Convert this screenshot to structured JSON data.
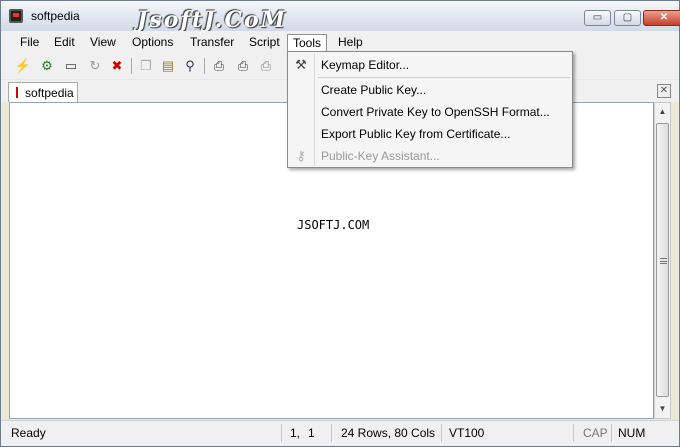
{
  "window": {
    "title": "softpedia",
    "watermark": "JsoftJ.CoM",
    "controls": {
      "minimize": "▭",
      "maximize": "▢",
      "close": "✕"
    }
  },
  "menubar": {
    "items": [
      {
        "label": "File"
      },
      {
        "label": "Edit"
      },
      {
        "label": "View"
      },
      {
        "label": "Options"
      },
      {
        "label": "Transfer"
      },
      {
        "label": "Script"
      },
      {
        "label": "Tools"
      },
      {
        "label": "Help"
      }
    ],
    "open_menu": "Tools"
  },
  "toolbar": {
    "icons": [
      "connect-icon",
      "quick-connect-icon",
      "folder-icon",
      "reconnect-icon",
      "disconnect-icon",
      "copy-icon",
      "paste-icon",
      "find-icon",
      "print-icon",
      "print-setup-icon",
      "print-screen-icon"
    ]
  },
  "tabs": [
    {
      "label": "softpedia"
    }
  ],
  "terminal": {
    "content": "JSOFTJ.COM"
  },
  "tools_menu": {
    "items": [
      {
        "label": "Keymap Editor...",
        "icon": "keymap-icon",
        "enabled": true
      },
      {
        "label": "Create Public Key...",
        "icon": "",
        "enabled": true
      },
      {
        "label": "Convert Private Key to OpenSSH Format...",
        "icon": "",
        "enabled": true
      },
      {
        "label": "Export Public Key from Certificate...",
        "icon": "",
        "enabled": true
      },
      {
        "label": "Public-Key Assistant...",
        "icon": "key-icon",
        "enabled": false
      }
    ]
  },
  "statusbar": {
    "status": "Ready",
    "row": "1,",
    "col": "1",
    "size": "24 Rows, 80 Cols",
    "emulation": "VT100",
    "cap": "CAP",
    "num": "NUM"
  }
}
